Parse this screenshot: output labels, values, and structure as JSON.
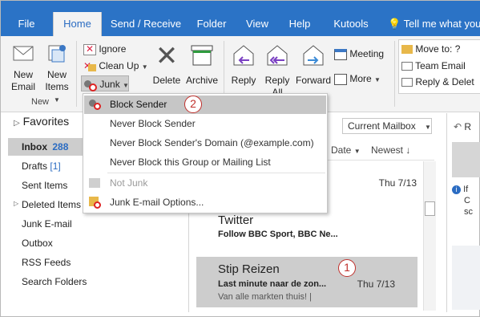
{
  "tabs": [
    "File",
    "Home",
    "Send / Receive",
    "Folder",
    "View",
    "Help",
    "Kutools"
  ],
  "tell_me": "Tell me what you",
  "ribbon": {
    "new_email": [
      "New",
      "Email"
    ],
    "new_items": [
      "New",
      "Items"
    ],
    "new_group": "New",
    "ignore": "Ignore",
    "clean_up": "Clean Up",
    "junk": "Junk",
    "delete": "Delete",
    "archive": "Archive",
    "reply": "Reply",
    "reply_all": [
      "Reply",
      "All"
    ],
    "forward": "Forward",
    "meeting": "Meeting",
    "more": "More",
    "move_to": "Move to: ?",
    "team_email": "Team Email",
    "reply_delete": "Reply & Delet"
  },
  "junk_menu": {
    "items": [
      {
        "label": "Block Sender",
        "state": "highlighted"
      },
      {
        "label": "Never Block Sender",
        "state": "normal"
      },
      {
        "label": "Never Block Sender's Domain (@example.com)",
        "state": "normal"
      },
      {
        "label": "Never Block this Group or Mailing List",
        "state": "normal"
      },
      {
        "label": "Not Junk",
        "state": "disabled"
      },
      {
        "label": "Junk E-mail Options...",
        "state": "normal"
      }
    ]
  },
  "callouts": [
    "2",
    "1"
  ],
  "nav": {
    "favorites": "Favorites",
    "folders": [
      {
        "label": "Inbox",
        "count": "288"
      },
      {
        "label": "Drafts",
        "count": "[1]"
      },
      {
        "label": "Sent Items",
        "count": ""
      },
      {
        "label": "Deleted Items",
        "count": ""
      },
      {
        "label": "Junk E-mail",
        "count": ""
      },
      {
        "label": "Outbox",
        "count": ""
      },
      {
        "label": "RSS Feeds",
        "count": ""
      },
      {
        "label": "Search Folders",
        "count": ""
      }
    ]
  },
  "search_scope": "Current Mailbox",
  "sort": {
    "by": "Date",
    "order": "Newest"
  },
  "messages": [
    {
      "sender": "",
      "subject": "",
      "preview": "",
      "date": "Thu 7/13"
    },
    {
      "sender": "Twitter",
      "subject": "Follow BBC Sport, BBC Ne...",
      "preview": "",
      "date": ""
    },
    {
      "sender": "Stip Reizen",
      "subject": "Last minute naar de zon...",
      "preview": "Van alle markten thuis! |",
      "date": "Thu 7/13"
    }
  ],
  "reading_pane": {
    "label": "R",
    "info_glyphs": [
      "If",
      "C",
      "sc"
    ]
  },
  "colors": {
    "tabbar": "#2b73c6",
    "highlight": "#c6c6c6",
    "selected_row": "#cdcdcd",
    "callout": "#c0302c"
  }
}
